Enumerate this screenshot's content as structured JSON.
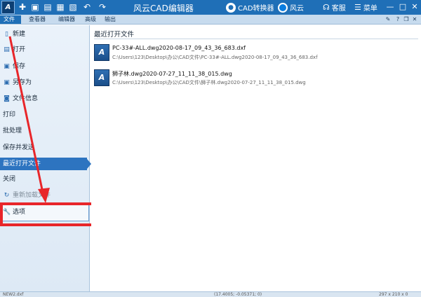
{
  "app": {
    "logo_text": "A",
    "title": "风云CAD编辑器"
  },
  "titlebar": {
    "cad_converter": "CAD转换器",
    "fengyun": "风云",
    "service": "客服",
    "menu": "菜单"
  },
  "menubar": {
    "tabs": [
      "文件",
      "查看器",
      "编辑器",
      "高级",
      "输出"
    ]
  },
  "sidebar": {
    "items": [
      {
        "label": "新建",
        "icon": "new-file-icon",
        "glyph": "▯"
      },
      {
        "label": "打开",
        "icon": "open-folder-icon",
        "glyph": "▤"
      },
      {
        "label": "保存",
        "icon": "save-icon",
        "glyph": "▣"
      },
      {
        "label": "另存为",
        "icon": "save-as-icon",
        "glyph": "▣"
      },
      {
        "label": "文件信息",
        "icon": "file-info-icon",
        "glyph": "◙"
      },
      {
        "label": "打印"
      },
      {
        "label": "批处理"
      },
      {
        "label": "保存并发送"
      },
      {
        "label": "最近打开文件"
      },
      {
        "label": "关闭"
      },
      {
        "label": "重新加载文件",
        "icon": "reload-icon",
        "glyph": "↻"
      },
      {
        "label": "选项",
        "icon": "options-icon",
        "glyph": "🔧"
      }
    ]
  },
  "content": {
    "title": "最近打开文件",
    "files": [
      {
        "name": "PC-33#-ALL.dwg2020-08-17_09_43_36_683.dxf",
        "path": "C:\\Users\\123\\Desktop\\办公\\CAD文件\\PC-33#-ALL.dwg2020-08-17_09_43_36_683.dxf",
        "icon_text": "A"
      },
      {
        "name": "狮子林.dwg2020-07-27_11_11_38_015.dwg",
        "path": "C:\\Users\\123\\Desktop\\办公\\CAD文件\\狮子林.dwg2020-07-27_11_11_38_015.dwg",
        "icon_text": "A"
      }
    ]
  },
  "statusbar": {
    "left": "NEW2.dxf",
    "middle": "(17.4005; -0.05371; 0)",
    "right": "297 x 210 x 0"
  },
  "colors": {
    "titlebar": "#1f6fb7",
    "selected": "#2d74c0",
    "annotation": "#e8262a"
  }
}
